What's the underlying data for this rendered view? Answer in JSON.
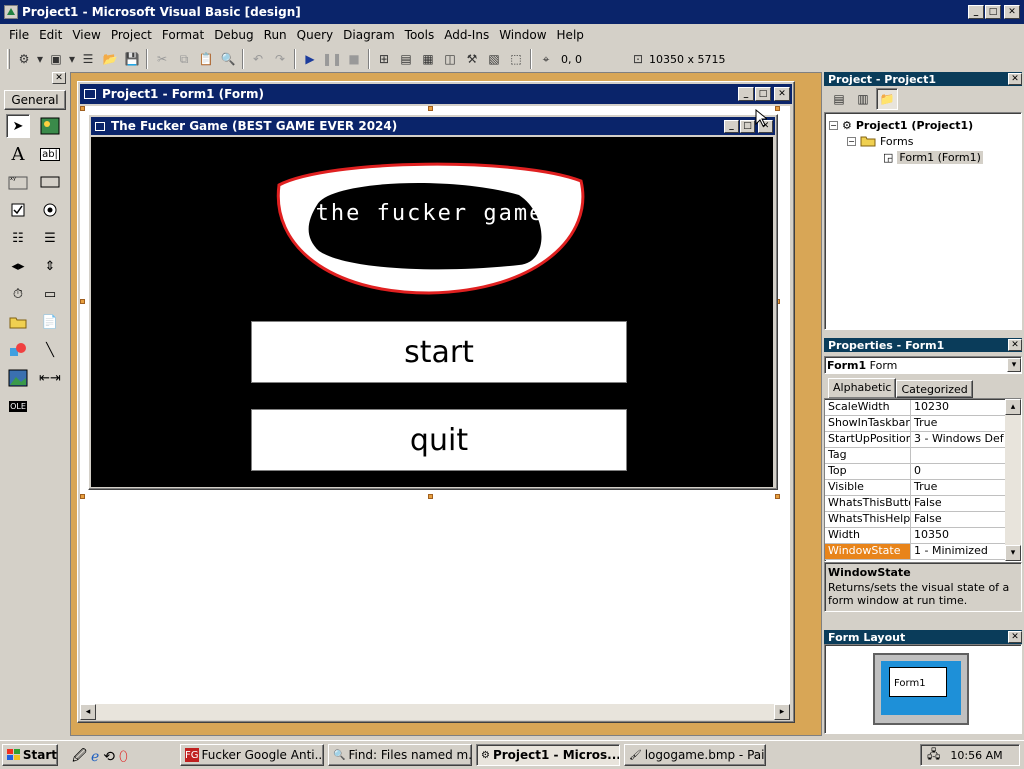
{
  "app": {
    "title": "Project1 - Microsoft Visual Basic [design]"
  },
  "menu": [
    "File",
    "Edit",
    "View",
    "Project",
    "Format",
    "Debug",
    "Run",
    "Query",
    "Diagram",
    "Tools",
    "Add-Ins",
    "Window",
    "Help"
  ],
  "toolbar": {
    "position": "0, 0",
    "size": "10350 x 5715"
  },
  "toolbox": {
    "tab_label": "General"
  },
  "form_designer": {
    "title": "Project1 - Form1 (Form)",
    "inner_title": "The Fucker Game (BEST GAME EVER 2024)",
    "logo_text": "the fucker game",
    "start_label": "start",
    "quit_label": "quit"
  },
  "project_panel": {
    "title": "Project - Project1",
    "root": "Project1 (Project1)",
    "folder": "Forms",
    "item": "Form1 (Form1)"
  },
  "properties_panel": {
    "title": "Properties - Form1",
    "object_name": "Form1",
    "object_type": "Form",
    "tab_alpha": "Alphabetic",
    "tab_cat": "Categorized",
    "rows": [
      {
        "name": "ScaleWidth",
        "value": "10230"
      },
      {
        "name": "ShowInTaskbar",
        "value": "True"
      },
      {
        "name": "StartUpPosition",
        "value": "3 - Windows Def"
      },
      {
        "name": "Tag",
        "value": ""
      },
      {
        "name": "Top",
        "value": "0"
      },
      {
        "name": "Visible",
        "value": "True"
      },
      {
        "name": "WhatsThisButton",
        "value": "False"
      },
      {
        "name": "WhatsThisHelp",
        "value": "False"
      },
      {
        "name": "Width",
        "value": "10350"
      },
      {
        "name": "WindowState",
        "value": "1 - Minimized"
      }
    ],
    "desc_title": "WindowState",
    "desc_text": "Returns/sets the visual state of a form window at run time."
  },
  "layout_panel": {
    "title": "Form Layout",
    "form_label": "Form1"
  },
  "taskbar": {
    "start": "Start",
    "tasks": [
      "Fucker Google Anti...",
      "Find: Files named m...",
      "Project1 - Micros...",
      "logogame.bmp - Paint"
    ],
    "clock": "10:56 AM"
  },
  "colors": {
    "titlebar": "#0a246a",
    "panel_title": "#0a3c5a",
    "desktop_sand": "#d8a656",
    "selection": "#e8841a",
    "logo_outline": "#e02020"
  }
}
